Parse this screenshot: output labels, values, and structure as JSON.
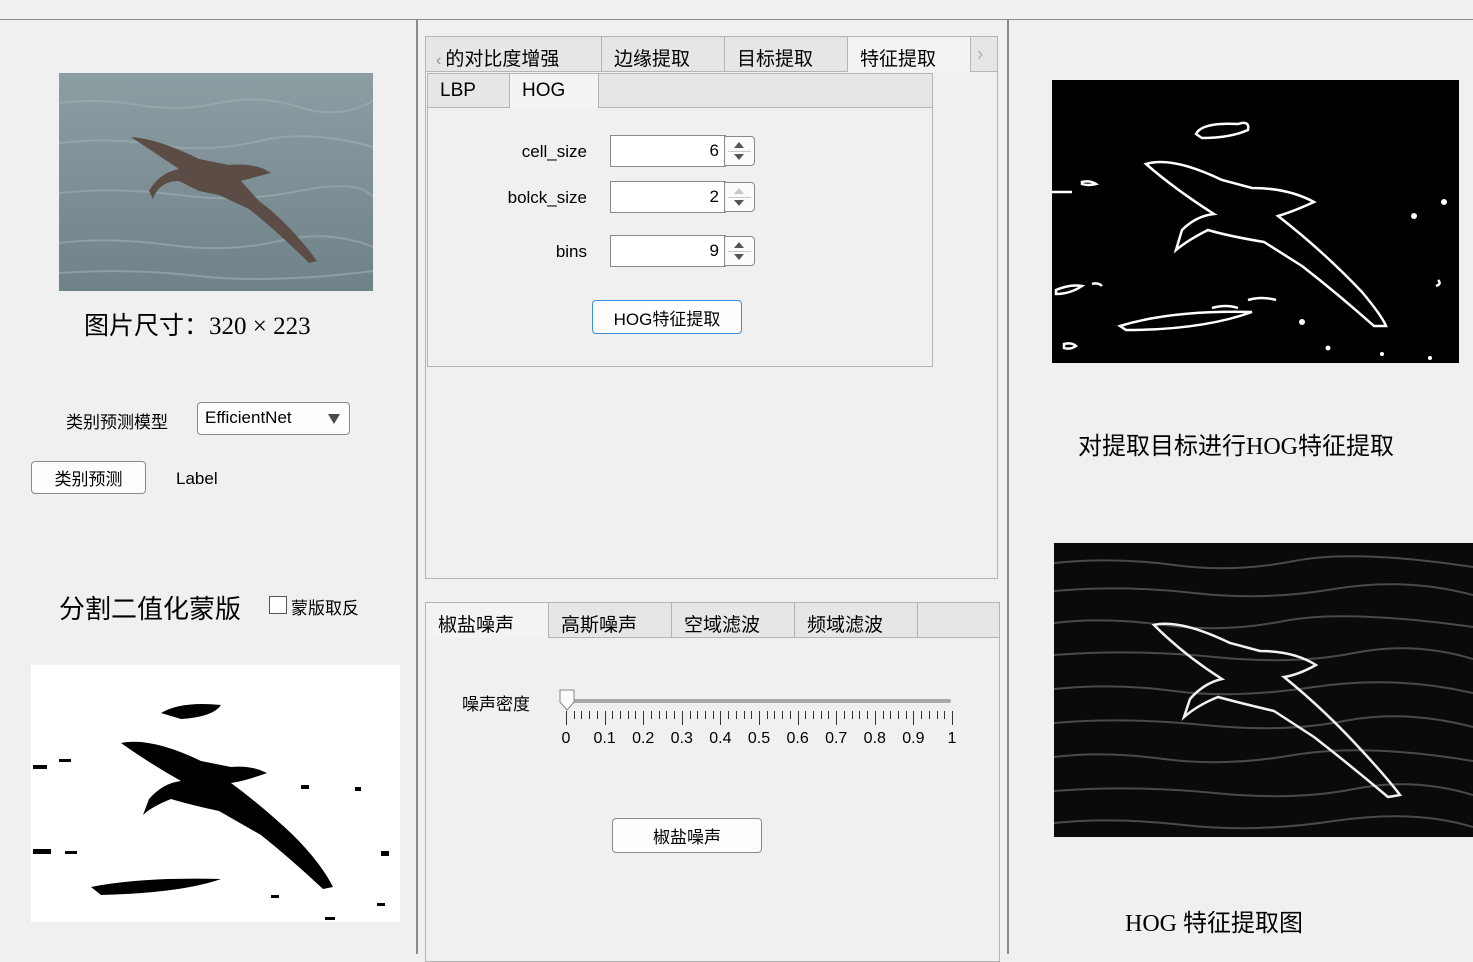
{
  "left": {
    "image_size_label": "图片尺寸：320 × 223",
    "model_label": "类别预测模型",
    "model_value": "EfficientNet",
    "predict_button": "类别预测",
    "result_label": "Label",
    "mask_title": "分割二值化蒙版",
    "invert_checkbox_label": "蒙版取反"
  },
  "top_panel": {
    "tabs": [
      {
        "label": "的对比度增强"
      },
      {
        "label": "边缘提取"
      },
      {
        "label": "目标提取"
      },
      {
        "label": "特征提取"
      }
    ],
    "active_tab": "特征提取",
    "subtabs": [
      {
        "label": "LBP"
      },
      {
        "label": "HOG"
      }
    ],
    "active_subtab": "HOG",
    "fields": [
      {
        "label": "cell_size",
        "value": "6"
      },
      {
        "label": "bolck_size",
        "value": "2"
      },
      {
        "label": "bins",
        "value": "9"
      }
    ],
    "hog_button": "HOG特征提取"
  },
  "bottom_panel": {
    "tabs": [
      {
        "label": "椒盐噪声"
      },
      {
        "label": "高斯噪声"
      },
      {
        "label": "空域滤波"
      },
      {
        "label": "频域滤波"
      }
    ],
    "active_tab": "椒盐噪声",
    "slider_label": "噪声密度",
    "slider_value": 0,
    "slider_ticks": [
      "0",
      "0.1",
      "0.2",
      "0.3",
      "0.4",
      "0.5",
      "0.6",
      "0.7",
      "0.8",
      "0.9",
      "1"
    ],
    "apply_button": "椒盐噪声"
  },
  "right": {
    "caption_1": "对提取目标进行HOG特征提取",
    "caption_2": "HOG 特征提取图"
  },
  "colors": {
    "window_bg": "#f0f0f0",
    "focus_border": "#3c8fd6",
    "divider": "#8a8a8a"
  }
}
